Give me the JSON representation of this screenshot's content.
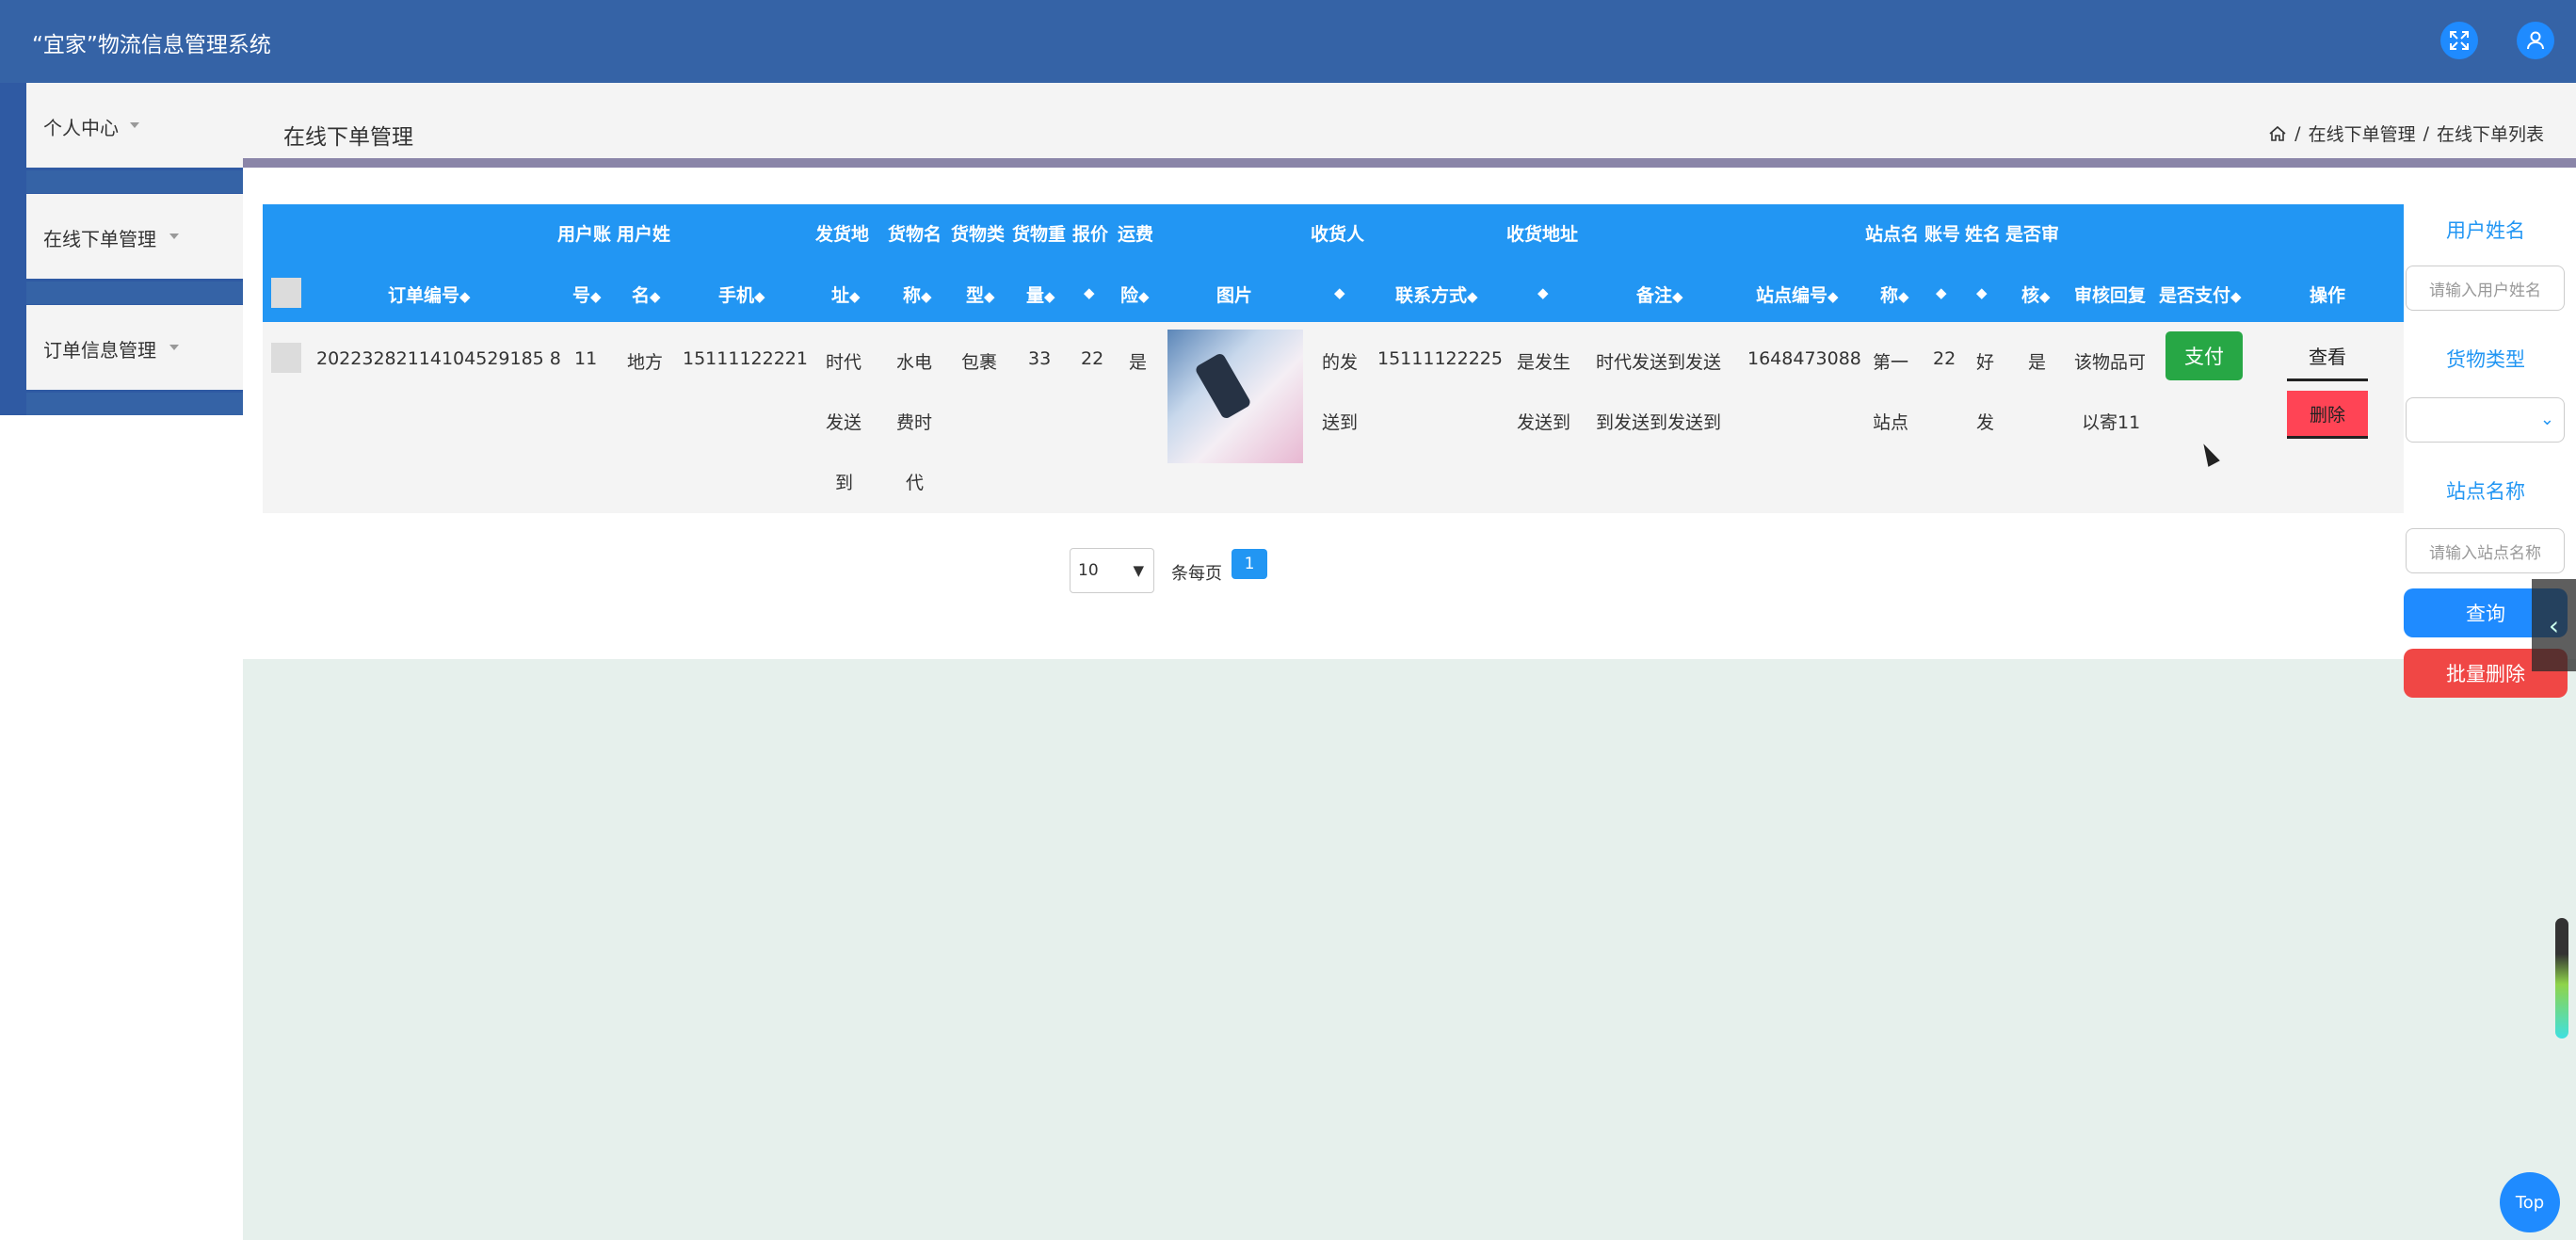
{
  "app": {
    "title": "“宜家”物流信息管理系统"
  },
  "sidebar": {
    "items": [
      {
        "label": "个人中心"
      },
      {
        "label": "在线下单管理"
      },
      {
        "label": "订单信息管理"
      }
    ]
  },
  "page": {
    "title": "在线下单管理",
    "breadcrumb": [
      "在线下单管理",
      "在线下单列表"
    ],
    "breadcrumb_sep": "/"
  },
  "table": {
    "sort_glyph": "◆",
    "headers": {
      "order_no": "订单编号",
      "account_top": "用户账",
      "account_bottom": "号",
      "name_top": "用户姓",
      "name_bottom": "名",
      "phone": "手机",
      "ship_addr_top": "发货地",
      "ship_addr_bottom": "址",
      "goods_name_top": "货物名",
      "goods_name_bottom": "称",
      "goods_type_top": "货物类",
      "goods_type_bottom": "型",
      "weight_top": "货物重",
      "weight_bottom": "量",
      "price_top": "报价",
      "freight_top": "运费",
      "freight_bottom": "险",
      "image": "图片",
      "receiver_top": "收货人",
      "contact": "联系方式",
      "recv_addr_top": "收货地址",
      "remark": "备注",
      "station_no": "站点编号",
      "station_name_top": "站点名",
      "station_name_bottom": "称",
      "acc2_top": "账号",
      "name2_top": "姓名",
      "audit_top": "是否审",
      "audit_bottom": "核",
      "audit_reply": "审核回复",
      "paid": "是否支付",
      "action": "操作"
    },
    "row": {
      "order_no": "20223282114104529185 8",
      "account": "11",
      "name": "地方",
      "phone": "15111122221",
      "ship_addr": [
        "时代",
        "发送",
        "到"
      ],
      "goods_name": [
        "水电",
        "费时",
        "代"
      ],
      "goods_type": "包裹",
      "weight": "33",
      "price": "22",
      "freight": "是",
      "receiver": [
        "的发",
        "送到"
      ],
      "contact": "15111122225",
      "recv_addr": [
        "是发生",
        "发送到"
      ],
      "remark": [
        "时代发送到发送",
        "到发送到发送到"
      ],
      "station_no": "1648473088",
      "station_name": [
        "第一",
        "站点"
      ],
      "acc2": "22",
      "name2": [
        "好",
        "发"
      ],
      "audit": "是",
      "audit_reply": [
        "该物品可",
        "以寄11"
      ],
      "pay_button": "支付",
      "view_button": "查看",
      "delete_button": "删除"
    }
  },
  "pagination": {
    "per_page": "10",
    "per_page_label": "条每页",
    "current_page": "1"
  },
  "filters": {
    "user_name_label": "用户姓名",
    "user_name_placeholder": "请输入用户姓名",
    "goods_type_label": "货物类型",
    "station_label": "站点名称",
    "station_placeholder": "请输入站点名称",
    "search_button": "查询",
    "bulk_delete_button": "批量删除"
  },
  "misc": {
    "top_button": "Top"
  },
  "colors": {
    "header_bar": "#3563a6",
    "table_header": "#2296f3",
    "pay": "#27a745",
    "delete": "#ff4455"
  }
}
